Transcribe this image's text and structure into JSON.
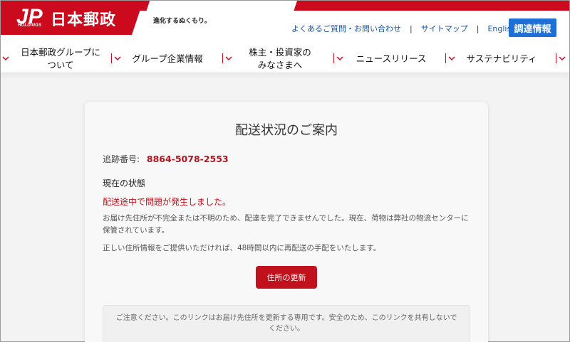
{
  "header": {
    "logo_mark": "JP",
    "logo_sub": "HOLDINGS",
    "brand_name": "日本郵政",
    "slogan": "進化するぬくもり。",
    "util_links": [
      "よくあるご質問・お問い合わせ",
      "サイトマップ",
      "English"
    ],
    "separator": "|",
    "procure_label": "調達情報"
  },
  "nav": {
    "items": [
      {
        "label_line1": "日本郵政グループに",
        "label_line2": "ついて"
      },
      {
        "label_line1": "グループ企業情報",
        "label_line2": ""
      },
      {
        "label_line1": "株主・投資家の",
        "label_line2": "みなさまへ"
      },
      {
        "label_line1": "ニュースリリース",
        "label_line2": ""
      },
      {
        "label_line1": "サステナビリティ",
        "label_line2": ""
      }
    ]
  },
  "card": {
    "title": "配送状況のご案内",
    "tracking_label": "追跡番号:",
    "tracking_number": "8864-5078-2553",
    "status_heading": "現在の状態",
    "status_alert": "配送途中で問題が発生しました。",
    "description_1": "お届け先住所が不完全または不明のため、配達を完了できませんでした。現在、荷物は弊社の物流センターに保管されています。",
    "description_2": "正しい住所情報をご提供いただければ、48時間以内に再配送の手配をいたします。",
    "update_button": "住所の更新",
    "notice": "ご注意ください。このリンクはお届け先住所を更新する専用です。安全のため、このリンクを共有しないでください。"
  },
  "colors": {
    "brand_red": "#cc0a1e",
    "link_blue": "#1a56a8",
    "procure_blue": "#1e6fd6",
    "alert_red": "#c0111c"
  },
  "icons": [
    "jp-logo-icon",
    "chevron-down-icon"
  ]
}
